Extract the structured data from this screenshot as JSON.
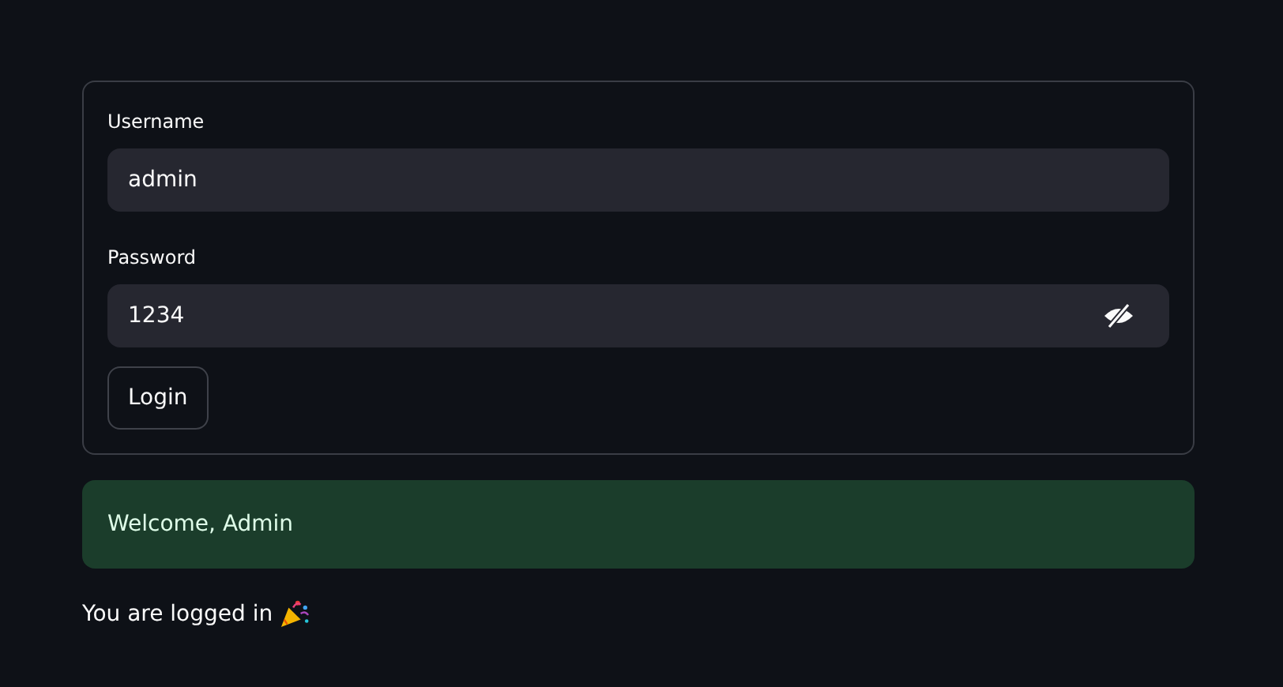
{
  "form": {
    "fields": [
      {
        "label": "Username",
        "value": "admin",
        "kind": "text"
      },
      {
        "label": "Password",
        "value": "1234",
        "kind": "password",
        "revealed": true
      }
    ],
    "button": "Login"
  },
  "alert": {
    "kind": "success",
    "text": "Welcome, Admin"
  },
  "message": {
    "text": "You are logged in"
  }
}
